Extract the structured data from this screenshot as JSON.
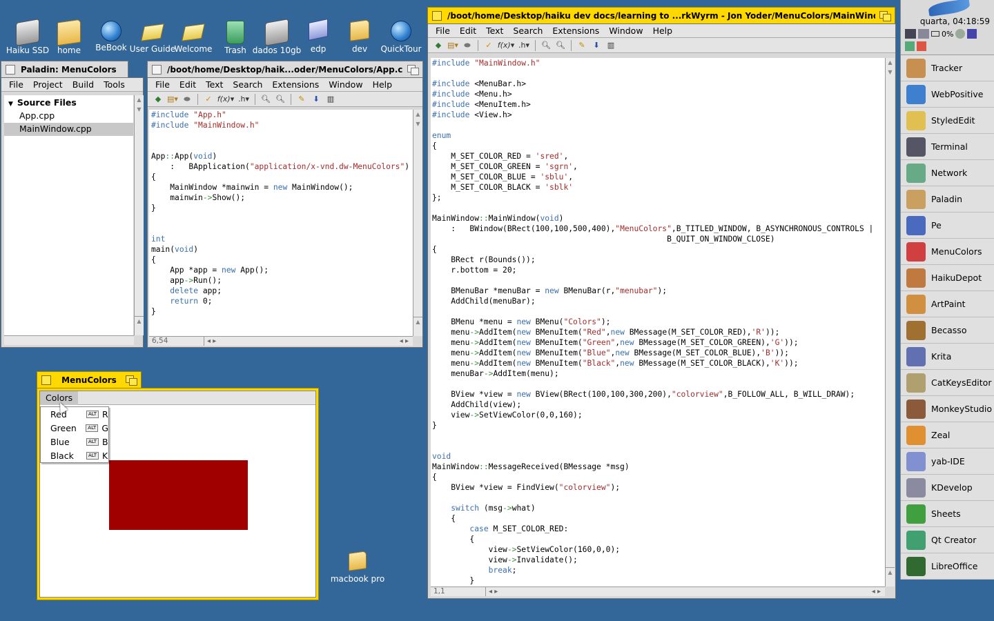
{
  "desktop_icons": [
    {
      "label": "Haiku SSD",
      "icon": "disk-icon"
    },
    {
      "label": "home",
      "icon": "home-folder-icon"
    },
    {
      "label": "BeBook",
      "icon": "globe-icon"
    },
    {
      "label": "User Guide",
      "icon": "book-icon"
    },
    {
      "label": "Welcome",
      "icon": "book-icon"
    },
    {
      "label": "Trash",
      "icon": "trash-icon"
    },
    {
      "label": "dados 10gb",
      "icon": "disk-icon"
    },
    {
      "label": "edp",
      "icon": "edp-icon"
    },
    {
      "label": "dev",
      "icon": "folder-icon"
    },
    {
      "label": "QuickTour",
      "icon": "globe-icon"
    },
    {
      "label": "macbook pro",
      "icon": "folder-icon"
    }
  ],
  "paladin": {
    "title": "Paladin: MenuColors",
    "menu": [
      "File",
      "Project",
      "Build",
      "Tools"
    ],
    "group": "Source Files",
    "files": [
      "App.cpp",
      "MainWindow.cpp"
    ]
  },
  "pe_app": {
    "title": "/boot/home/Desktop/haik...oder/MenuColors/App.cpp",
    "menu": [
      "File",
      "Edit",
      "Text",
      "Search",
      "Extensions",
      "Window",
      "Help"
    ],
    "position": "6,54"
  },
  "pe_main": {
    "title": "/boot/home/Desktop/haiku dev docs/learning to ...rkWyrm - Jon Yoder/MenuColors/MainWindow.cpp",
    "menu": [
      "File",
      "Edit",
      "Text",
      "Search",
      "Extensions",
      "Window",
      "Help"
    ],
    "position": "1,1"
  },
  "menucolors": {
    "title": "MenuColors",
    "menu_label": "Colors",
    "items": [
      {
        "label": "Red",
        "key": "R"
      },
      {
        "label": "Green",
        "key": "G"
      },
      {
        "label": "Blue",
        "key": "B"
      },
      {
        "label": "Black",
        "key": "K"
      }
    ],
    "alt_label": "ALT",
    "view_color": "#a00000"
  },
  "deskbar": {
    "clock": "quarta, 04:18:59",
    "battery": "0%",
    "apps": [
      "Tracker",
      "WebPositive",
      "StyledEdit",
      "Terminal",
      "Network",
      "Paladin",
      "Pe",
      "MenuColors",
      "HaikuDepot",
      "ArtPaint",
      "Becasso",
      "Krita",
      "CatKeysEditor",
      "MonkeyStudio",
      "Zeal",
      "yab-IDE",
      "KDevelop",
      "Sheets",
      "Qt Creator",
      "LibreOffice"
    ]
  },
  "code_app": [
    "#include \"App.h\"",
    "#include \"MainWindow.h\"",
    "",
    "",
    "App::App(void)",
    "    :   BApplication(\"application/x-vnd.dw-MenuColors\")",
    "{",
    "    MainWindow *mainwin = new MainWindow();",
    "    mainwin->Show();",
    "}",
    "",
    "",
    "int",
    "main(void)",
    "{",
    "    App *app = new App();",
    "    app->Run();",
    "    delete app;",
    "    return 0;",
    "}"
  ],
  "code_main": [
    "#include \"MainWindow.h\"",
    "",
    "#include <MenuBar.h>",
    "#include <Menu.h>",
    "#include <MenuItem.h>",
    "#include <View.h>",
    "",
    "enum",
    "{",
    "    M_SET_COLOR_RED = 'sred',",
    "    M_SET_COLOR_GREEN = 'sgrn',",
    "    M_SET_COLOR_BLUE = 'sblu',",
    "    M_SET_COLOR_BLACK = 'sblk'",
    "};",
    "",
    "MainWindow::MainWindow(void)",
    "    :   BWindow(BRect(100,100,500,400),\"MenuColors\",B_TITLED_WINDOW, B_ASYNCHRONOUS_CONTROLS |",
    "                                                  B_QUIT_ON_WINDOW_CLOSE)",
    "{",
    "    BRect r(Bounds());",
    "    r.bottom = 20;",
    "",
    "    BMenuBar *menuBar = new BMenuBar(r,\"menubar\");",
    "    AddChild(menuBar);",
    "",
    "    BMenu *menu = new BMenu(\"Colors\");",
    "    menu->AddItem(new BMenuItem(\"Red\",new BMessage(M_SET_COLOR_RED),'R'));",
    "    menu->AddItem(new BMenuItem(\"Green\",new BMessage(M_SET_COLOR_GREEN),'G'));",
    "    menu->AddItem(new BMenuItem(\"Blue\",new BMessage(M_SET_COLOR_BLUE),'B'));",
    "    menu->AddItem(new BMenuItem(\"Black\",new BMessage(M_SET_COLOR_BLACK),'K'));",
    "    menuBar->AddItem(menu);",
    "",
    "    BView *view = new BView(BRect(100,100,300,200),\"colorview\",B_FOLLOW_ALL, B_WILL_DRAW);",
    "    AddChild(view);",
    "    view->SetViewColor(0,0,160);",
    "}",
    "",
    "",
    "void",
    "MainWindow::MessageReceived(BMessage *msg)",
    "{",
    "    BView *view = FindView(\"colorview\");",
    "",
    "    switch (msg->what)",
    "    {",
    "        case M_SET_COLOR_RED:",
    "        {",
    "            view->SetViewColor(160,0,0);",
    "            view->Invalidate();",
    "            break;",
    "        }"
  ]
}
